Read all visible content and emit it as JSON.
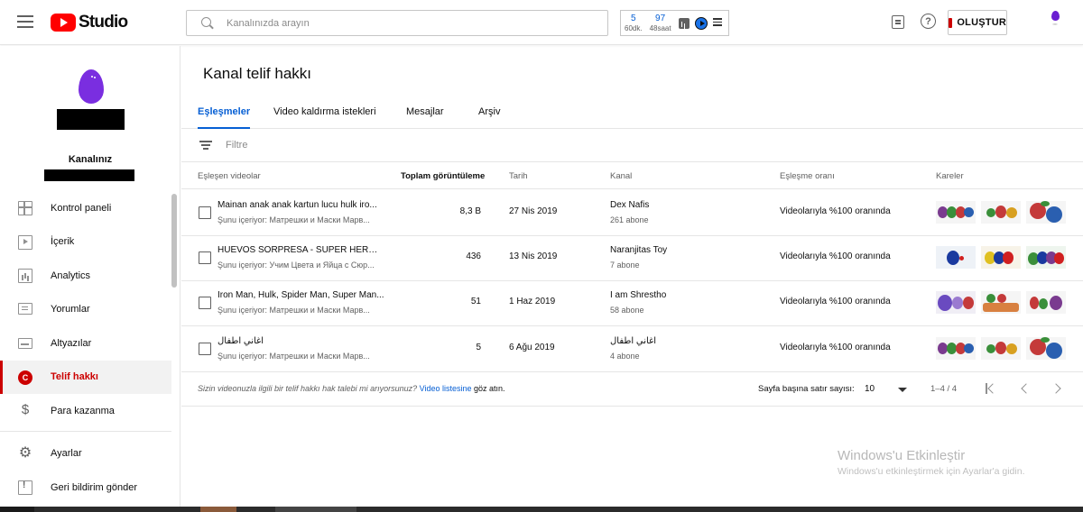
{
  "header": {
    "logo_text": "Studio",
    "search_placeholder": "Kanalınızda arayın",
    "stats": [
      {
        "value": "5",
        "label": "60dk."
      },
      {
        "value": "97",
        "label": "48saat"
      }
    ],
    "create_label": "OLUŞTUR"
  },
  "sidebar": {
    "channel_label": "Kanalınız",
    "items": [
      {
        "label": "Kontrol paneli",
        "icon": "dashboard-icon"
      },
      {
        "label": "İçerik",
        "icon": "content-icon"
      },
      {
        "label": "Analytics",
        "icon": "analytics-icon"
      },
      {
        "label": "Yorumlar",
        "icon": "comments-icon"
      },
      {
        "label": "Altyazılar",
        "icon": "subtitles-icon"
      },
      {
        "label": "Telif hakkı",
        "icon": "copyright-icon",
        "active": true
      },
      {
        "label": "Para kazanma",
        "icon": "dollar-icon"
      }
    ],
    "bottom_items": [
      {
        "label": "Ayarlar",
        "icon": "gear-icon"
      },
      {
        "label": "Geri bildirim gönder",
        "icon": "feedback-icon"
      }
    ]
  },
  "main": {
    "title": "Kanal telif hakkı",
    "tabs": [
      "Eşleşmeler",
      "Video kaldırma istekleri",
      "Mesajlar",
      "Arşiv"
    ],
    "filter_label": "Filtre",
    "columns": {
      "videos": "Eşleşen videolar",
      "views": "Toplam görüntüleme",
      "date": "Tarih",
      "channel": "Kanal",
      "match": "Eşleşme oranı",
      "frames": "Kareler"
    },
    "rows": [
      {
        "title": "Mainan anak anak kartun lucu hulk iro...",
        "contains": "Şunu içeriyor: Матрешки и Маски Марв...",
        "views": "8,3 B",
        "date": "27 Nis 2019",
        "channel": "Dex Nafis",
        "subscribers": "261 abone",
        "match": "Videolarıyla %100 oranında"
      },
      {
        "title": "HUEVOS SORPRESA - SUPER HEROES ...",
        "contains": "Şunu içeriyor: Учим Цвета и Яйца с Сюр...",
        "views": "436",
        "date": "13 Nis 2019",
        "channel": "Naranjitas Toy",
        "subscribers": "7 abone",
        "match": "Videolarıyla %100 oranında"
      },
      {
        "title": "Iron Man, Hulk, Spider Man, Super Man...",
        "contains": "Şunu içeriyor: Матрешки и Маски Марв...",
        "views": "51",
        "date": "1 Haz 2019",
        "channel": "I am Shrestho",
        "subscribers": "58 abone",
        "match": "Videolarıyla %100 oranında"
      },
      {
        "title": "اغاني اطفال",
        "contains": "Şunu içeriyor: Матрешки и Маски Марв...",
        "views": "5",
        "date": "6 Ağu 2019",
        "channel": "اغاني اطفال",
        "subscribers": "4 abone",
        "match": "Videolarıyla %100 oranında"
      }
    ],
    "footer": {
      "note_prefix": "Sizin videonuzla ilgili bir telif hakkı hak talebi mi arıyorsunuz?",
      "note_link": "Video listesine",
      "note_suffix": "göz atın.",
      "rows_per_page_label": "Sayfa başına satır sayısı:",
      "rows_per_page_value": "10",
      "range": "1–4 / 4"
    }
  },
  "watermark": {
    "title": "Windows'u Etkinleştir",
    "subtitle": "Windows'u etkinleştirmek için Ayarlar'a gidin."
  },
  "colors": {
    "brand_red": "#ff0000",
    "active_red": "#cc0000",
    "link_blue": "#065fd4"
  }
}
